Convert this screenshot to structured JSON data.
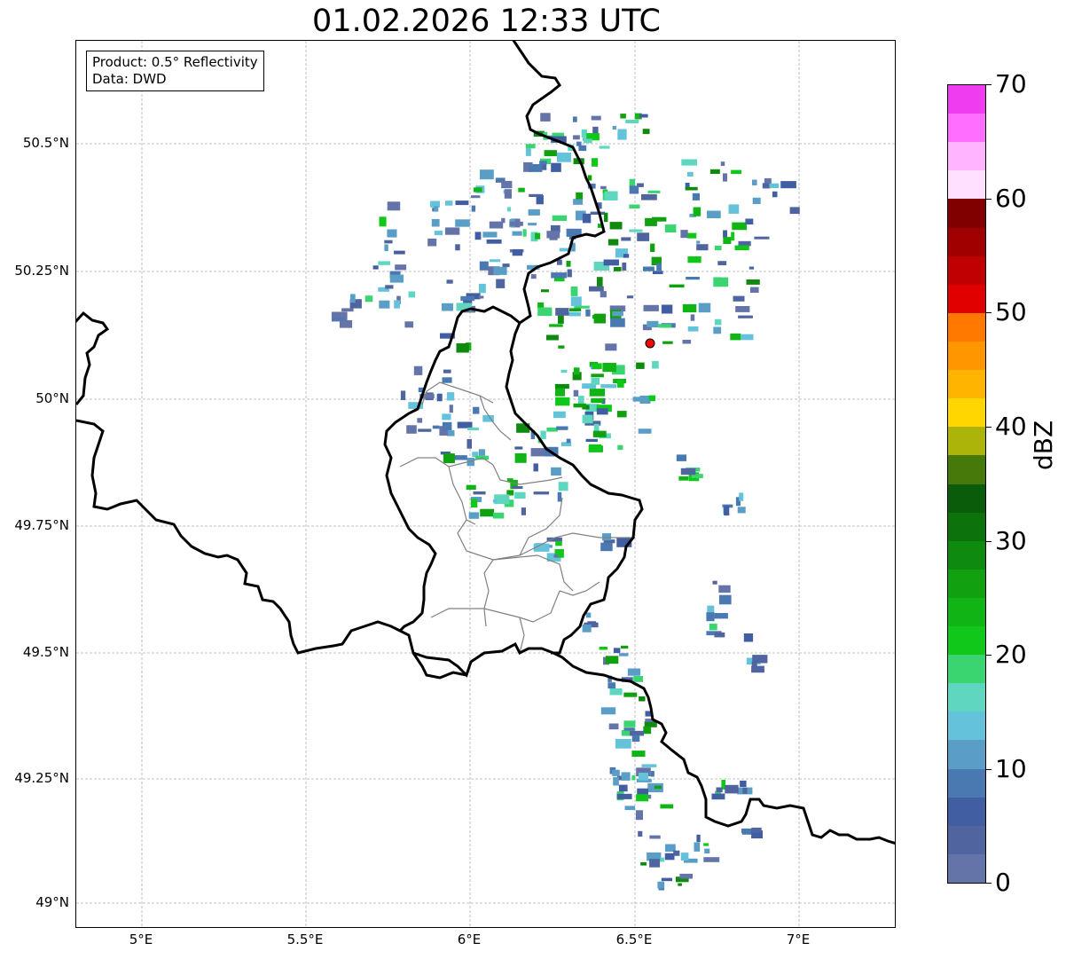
{
  "title": "01.02.2026 12:33 UTC",
  "info": {
    "product": "Product: 0.5° Reflectivity",
    "data": "Data: DWD"
  },
  "axes": {
    "lat_labels": [
      "50.5°N",
      "50.25°N",
      "50°N",
      "49.75°N",
      "49.5°N",
      "49.25°N",
      "49°N"
    ],
    "lon_labels": [
      "5°E",
      "5.5°E",
      "6°E",
      "6.5°E",
      "7°E"
    ]
  },
  "colorbar": {
    "unit": "dBZ",
    "labels": [
      "70",
      "60",
      "50",
      "40",
      "30",
      "20",
      "10",
      "0"
    ],
    "colors": [
      "#6473a8",
      "#50659f",
      "#415ea3",
      "#4a79b2",
      "#5a9ec8",
      "#64c2da",
      "#5fd7c0",
      "#3ad470",
      "#10c81a",
      "#10b515",
      "#10a010",
      "#0e8a0e",
      "#0c730c",
      "#0a5c0a",
      "#47780a",
      "#acb40a",
      "#ffd600",
      "#ffb400",
      "#ff9600",
      "#ff7800",
      "#e10000",
      "#c00000",
      "#a00000",
      "#800000",
      "#ffe0ff",
      "#ffb4ff",
      "#ff6eff",
      "#f03cf0"
    ]
  },
  "station": {
    "color": "#ff0000"
  }
}
